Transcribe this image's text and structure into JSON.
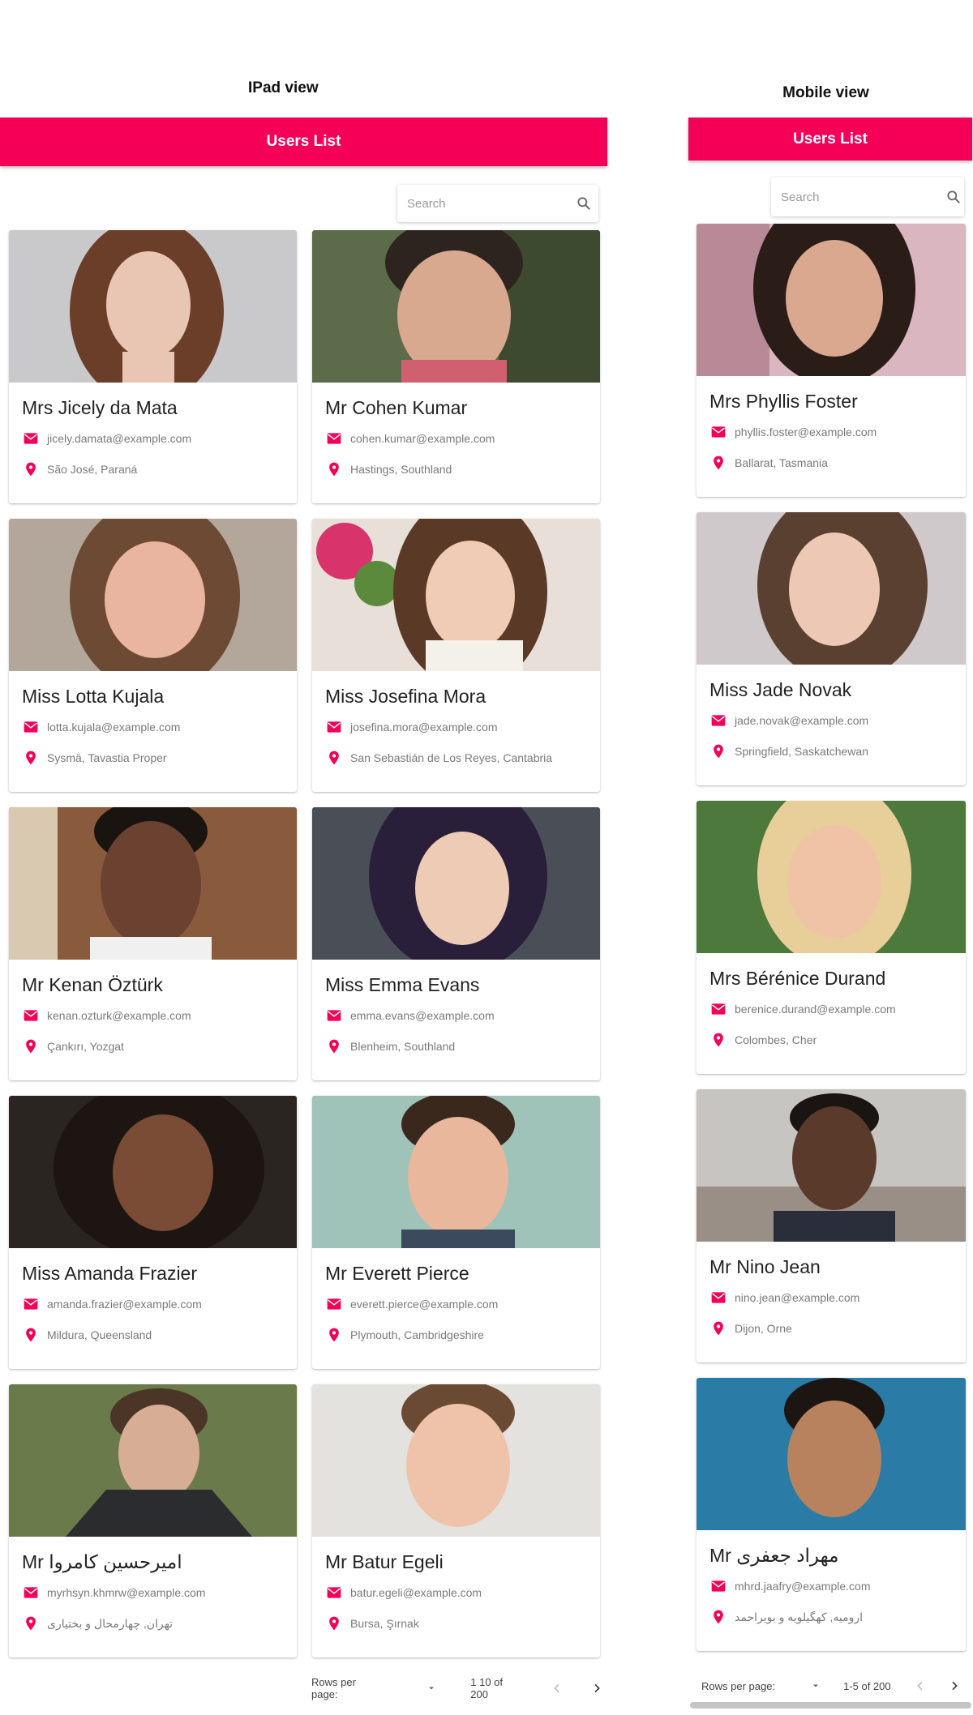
{
  "ipad": {
    "view_label": "IPad view",
    "app_title": "Users List",
    "search": {
      "placeholder": "Search"
    },
    "users": [
      {
        "name": "Mrs Jicely da Mata",
        "email": "jicely.damata@example.com",
        "location": "São José, Paraná"
      },
      {
        "name": "Mr Cohen Kumar",
        "email": "cohen.kumar@example.com",
        "location": "Hastings, Southland"
      },
      {
        "name": "Miss Lotta Kujala",
        "email": "lotta.kujala@example.com",
        "location": "Sysmä, Tavastia Proper"
      },
      {
        "name": "Miss Josefina Mora",
        "email": "josefina.mora@example.com",
        "location": "San Sebastián de Los Reyes, Cantabria"
      },
      {
        "name": "Mr Kenan Öztürk",
        "email": "kenan.ozturk@example.com",
        "location": "Çankırı, Yozgat"
      },
      {
        "name": "Miss Emma Evans",
        "email": "emma.evans@example.com",
        "location": "Blenheim, Southland"
      },
      {
        "name": "Miss Amanda Frazier",
        "email": "amanda.frazier@example.com",
        "location": "Mildura, Queensland"
      },
      {
        "name": "Mr Everett Pierce",
        "email": "everett.pierce@example.com",
        "location": "Plymouth, Cambridgeshire"
      },
      {
        "name": "Mr امیرحسین کامروا",
        "email": "myrhsyn.khmrw@example.com",
        "location": "تهران, چهارمحال و بختیاری"
      },
      {
        "name": "Mr Batur Egeli",
        "email": "batur.egeli@example.com",
        "location": "Bursa, Şırnak"
      }
    ],
    "pagination": {
      "rows_per_page_label": "Rows per page:",
      "range": "1 10 of 200"
    }
  },
  "mobile": {
    "view_label": "Mobile view",
    "app_title": "Users List",
    "search": {
      "placeholder": "Search"
    },
    "users": [
      {
        "name": "Mrs Phyllis Foster",
        "email": "phyllis.foster@example.com",
        "location": "Ballarat, Tasmania"
      },
      {
        "name": "Miss Jade Novak",
        "email": "jade.novak@example.com",
        "location": "Springfield, Saskatchewan"
      },
      {
        "name": "Mrs Bérénice Durand",
        "email": "berenice.durand@example.com",
        "location": "Colombes, Cher"
      },
      {
        "name": "Mr Nino Jean",
        "email": "nino.jean@example.com",
        "location": "Dijon, Orne"
      },
      {
        "name": "Mr مهراد جعفری",
        "email": "mhrd.jaafry@example.com",
        "location": "ارومیه, کهگیلویه و بویراحمد"
      }
    ],
    "pagination": {
      "rows_per_page_label": "Rows per page:",
      "range": "1-5 of 200"
    }
  },
  "colors": {
    "accent": "#f50057",
    "text": "#222222",
    "muted": "#7a7a7a"
  },
  "icons": {
    "search": "search-icon",
    "email": "email-icon",
    "location": "location-pin-icon",
    "dropdown": "dropdown-arrow-icon",
    "prev": "chevron-left-icon",
    "next": "chevron-right-icon"
  }
}
